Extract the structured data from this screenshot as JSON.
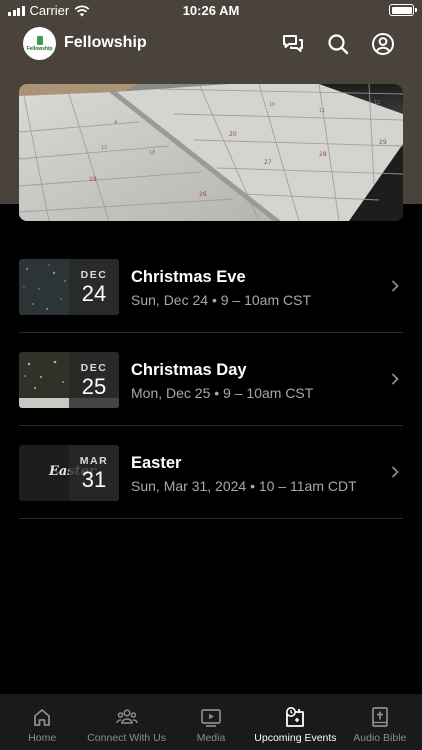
{
  "status_bar": {
    "carrier": "Carrier",
    "time": "10:26 AM"
  },
  "header": {
    "title": "Fellowship",
    "logo_text": "Fellowship"
  },
  "events": [
    {
      "month": "DEC",
      "day": "24",
      "title": "Christmas Eve",
      "subtitle": "Sun, Dec 24 • 9 – 10am CST"
    },
    {
      "month": "DEC",
      "day": "25",
      "title": "Christmas Day",
      "subtitle": "Mon, Dec 25 • 9 – 10am CST"
    },
    {
      "month": "MAR",
      "day": "31",
      "title": "Easter",
      "subtitle": "Sun, Mar 31, 2024 • 10 – 11am CDT",
      "thumb_text": "Easter"
    }
  ],
  "tabs": [
    {
      "label": "Home",
      "icon": "home-icon"
    },
    {
      "label": "Connect With Us",
      "icon": "people-icon"
    },
    {
      "label": "Media",
      "icon": "play-icon"
    },
    {
      "label": "Upcoming Events",
      "icon": "calendar-icon",
      "active": true
    },
    {
      "label": "Audio Bible",
      "icon": "bible-icon"
    }
  ],
  "colors": {
    "header_bg": "#4a433c",
    "background": "#000000",
    "accent_logo": "#3f9b4d"
  }
}
